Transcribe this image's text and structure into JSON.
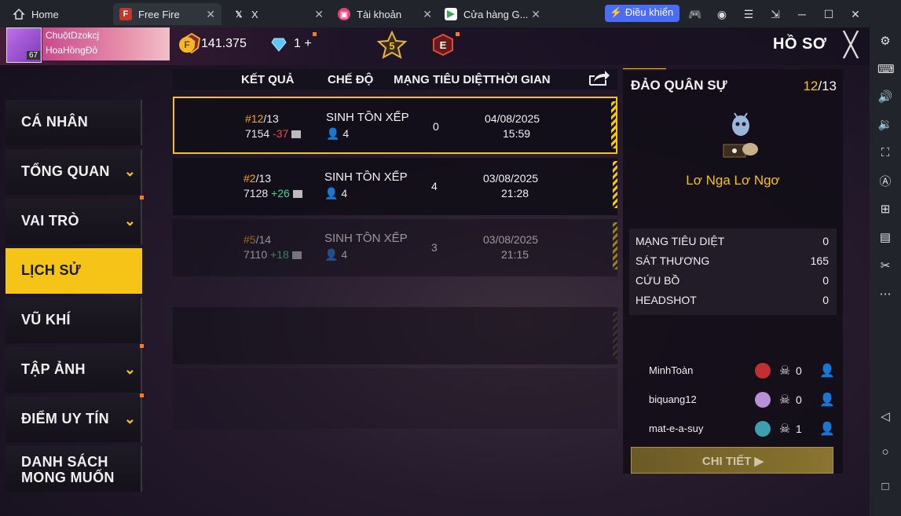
{
  "window": {
    "tabs": [
      {
        "label": "Home"
      },
      {
        "label": "Free Fire"
      },
      {
        "label": "X"
      },
      {
        "label": "Tài khoản"
      },
      {
        "label": "Cửa hàng G..."
      }
    ],
    "control_button": "Điều khiển"
  },
  "header": {
    "player_name": "ChuộtDzokcj",
    "guild_name": "HoaHồngĐỏ",
    "level": "67",
    "coins": "141.375",
    "diamonds": "1",
    "diamond_plus": "+",
    "rank_badge_number": "5",
    "elite_badge": "E",
    "title": "HỒ SƠ"
  },
  "menu": [
    {
      "label": "CÁ NHÂN",
      "chevron": false,
      "dot": false
    },
    {
      "label": "TỔNG QUAN",
      "chevron": true,
      "dot": false
    },
    {
      "label": "VAI TRÒ",
      "chevron": true,
      "dot": true
    },
    {
      "label": "LỊCH SỬ",
      "chevron": false,
      "dot": false,
      "active": true
    },
    {
      "label": "VŨ KHÍ",
      "chevron": false,
      "dot": false
    },
    {
      "label": "TẬP ẢNH",
      "chevron": true,
      "dot": true
    },
    {
      "label": "ĐIỂM UY TÍN",
      "chevron": true,
      "dot": true
    },
    {
      "label": "DANH SÁCH MONG MUỐN",
      "chevron": false,
      "dot": false
    }
  ],
  "table": {
    "headers": [
      "KẾT QUẢ",
      "CHẾ ĐỘ",
      "MẠNG TIÊU DIỆT",
      "THỜI GIAN"
    ],
    "rows": [
      {
        "rank": "#12",
        "total": "/13",
        "score": "7154",
        "delta": "-37",
        "mode": "SINH TỒN XẾP HẠ",
        "team": "4",
        "kills": "0",
        "date": "04/08/2025",
        "time": "15:59"
      },
      {
        "rank": "#2",
        "total": "/13",
        "score": "7128",
        "delta": "+26",
        "mode": "SINH TỒN XẾP HẠ",
        "team": "4",
        "kills": "4",
        "date": "03/08/2025",
        "time": "21:28"
      },
      {
        "rank": "#5",
        "total": "/14",
        "score": "7110",
        "delta": "+18",
        "mode": "SINH TỒN XẾP HẠ",
        "team": "4",
        "kills": "3",
        "date": "03/08/2025",
        "time": "21:15"
      }
    ]
  },
  "detail": {
    "map": "ĐẢO QUÂN SỰ",
    "rank": "12",
    "rank_total": "/13",
    "character_name": "Lơ Nga Lơ Ngơ",
    "stats": [
      {
        "label": "MẠNG TIÊU DIỆT",
        "value": "0"
      },
      {
        "label": "SÁT THƯƠNG",
        "value": "165"
      },
      {
        "label": "CỨU BỒ",
        "value": "0"
      },
      {
        "label": "HEADSHOT",
        "value": "0"
      }
    ],
    "players": [
      {
        "name": "MinhToàn",
        "kills": "0"
      },
      {
        "name": "biquang12",
        "kills": "0"
      },
      {
        "name": "mat-e-a-suy",
        "kills": "1"
      }
    ],
    "button": "CHI TIẾT"
  },
  "colors": {
    "accent": "#f5c417",
    "negative": "#e84b4b",
    "positive": "#3fd58a",
    "control": "#4a6cf7"
  }
}
